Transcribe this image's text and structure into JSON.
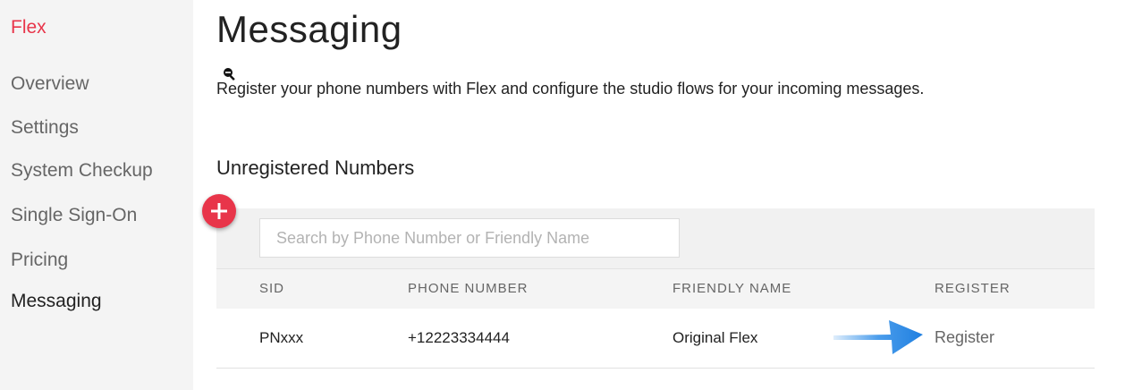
{
  "sidebar": {
    "brand": "Flex",
    "items": [
      {
        "label": "Overview",
        "active": false
      },
      {
        "label": "Settings",
        "active": false
      },
      {
        "label": "System Checkup",
        "active": false
      },
      {
        "label": "Single Sign-On",
        "active": false
      },
      {
        "label": "Pricing",
        "active": false
      },
      {
        "label": "Messaging",
        "active": true
      }
    ]
  },
  "main": {
    "title": "Messaging",
    "description": "Register your phone numbers with Flex and configure the studio flows for your incoming messages.",
    "section_title": "Unregistered Numbers",
    "add_button_icon": "plus-icon",
    "search": {
      "placeholder": "Search by Phone Number or Friendly Name",
      "value": ""
    },
    "table": {
      "columns": [
        "SID",
        "PHONE NUMBER",
        "FRIENDLY NAME",
        "REGISTER"
      ],
      "rows": [
        {
          "sid": "PNxxx",
          "phone_number": "+12223334444",
          "friendly_name": "Original Flex",
          "register": "Register"
        }
      ]
    },
    "annotation_icon": "arrow-right-icon"
  },
  "colors": {
    "accent": "#e8354a",
    "annotation_arrow": "#2b8ce8",
    "sidebar_bg": "#f4f4f4"
  }
}
